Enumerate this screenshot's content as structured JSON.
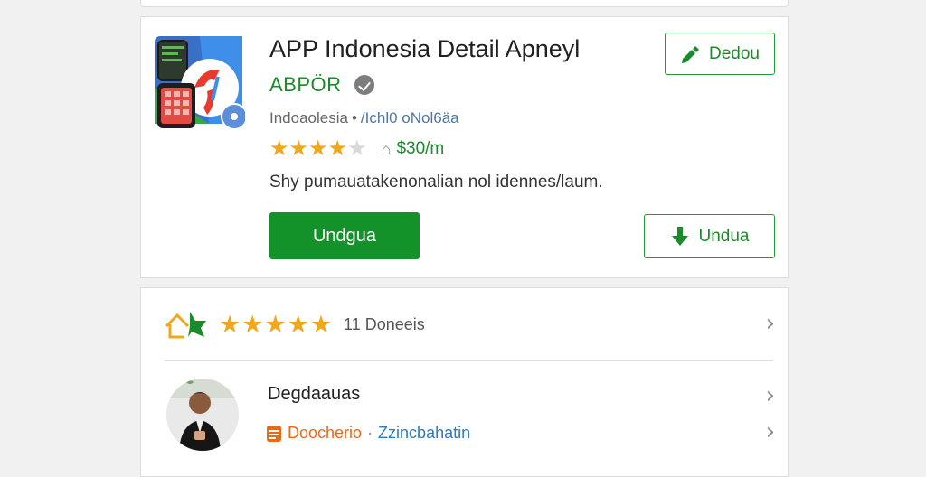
{
  "app": {
    "title": "APP Indonesia Detail Apneyl",
    "developer": "ABPÖR",
    "meta_left": "Indoaolesia",
    "meta_sep": "•",
    "meta_right": "/Ichl0 oNol6äa",
    "stars_text": "★★★★",
    "stars_half": "★",
    "rating_home": "⌂",
    "price": "$30/m",
    "description": "Shy pumauatakenonalian nol idennes/laum.",
    "install_label": "Undgua",
    "top_action_label": "Dedou",
    "download_label": "Undua",
    "accent": "#13922a"
  },
  "review": {
    "stars_text": "★★★★★",
    "count_label": "11 Doneeis",
    "chevron": "›",
    "reviewer_name": "Degdaauas",
    "meta_a": "Doocherio",
    "meta_sep": "·",
    "meta_b": "Zzincbahatin"
  },
  "icons": [
    "app-icon",
    "verified-badge-icon",
    "pencil-icon",
    "download-arrow-icon",
    "house-icon",
    "chevron-right-icon",
    "document-icon"
  ]
}
